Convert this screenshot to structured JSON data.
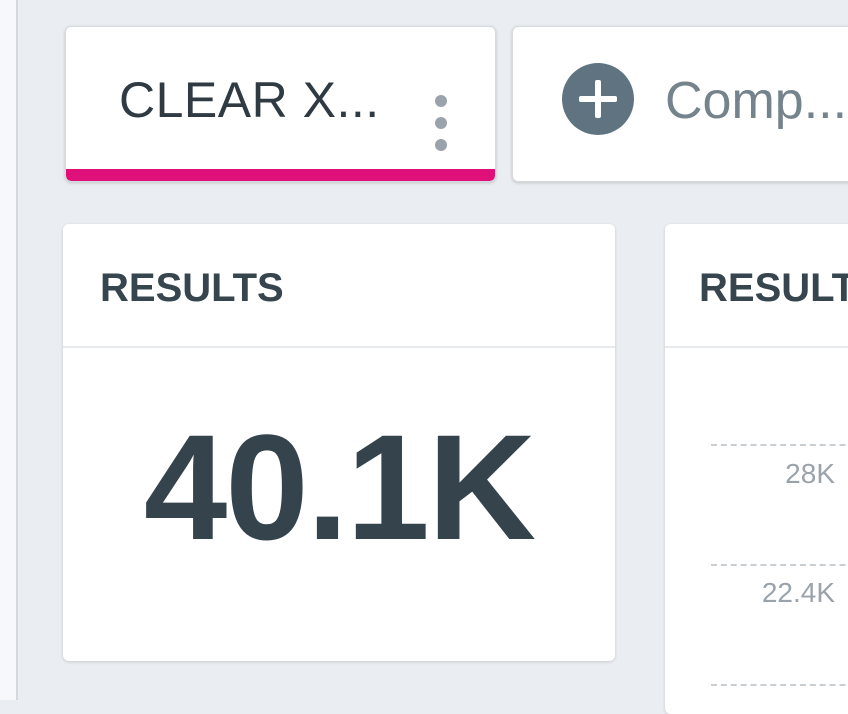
{
  "tabs": [
    {
      "label": "CLEAR X..."
    },
    {
      "label": "Comp..."
    }
  ],
  "cards": [
    {
      "title": "RESULTS",
      "value": "40.1K"
    },
    {
      "title": "RESULTS",
      "ticks": [
        "28K",
        "22.4K"
      ]
    }
  ],
  "colors": {
    "accent": "#e0107b",
    "background": "#eaedf1",
    "text_primary": "#35434d",
    "icon": "#5f7480"
  },
  "icons": {
    "tab_menu": "kebab-menu-icon",
    "add_tab": "plus-circle-icon"
  }
}
